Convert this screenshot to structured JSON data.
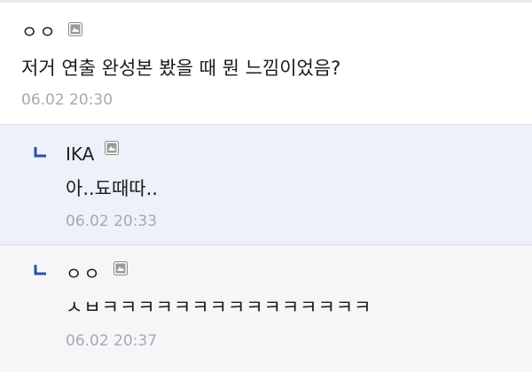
{
  "comments": [
    {
      "author": "ㅇㅇ",
      "text": "저거 연출 완성본 봤을 때 뭔 느낌이었음?",
      "time": "06.02 20:30",
      "icon": "picture-icon"
    },
    {
      "author": "IKA",
      "text": "아..됴때따..",
      "time": "06.02 20:33",
      "icon": "picture-icon",
      "reply_icon": "reply-arrow-icon"
    },
    {
      "author": "ㅇㅇ",
      "text": "ㅅㅂㅋㅋㅋㅋㅋㅋㅋㅋㅋㅋㅋㅋㅋㅋㅋ",
      "time": "06.02 20:37",
      "icon": "picture-icon",
      "reply_icon": "reply-arrow-icon"
    }
  ],
  "colors": {
    "reply_bg": "#eef1fa",
    "reply_bg_2": "#f6f6f8",
    "timestamp": "#a6a9b2",
    "reply_arrow": "#2f4fa8"
  }
}
